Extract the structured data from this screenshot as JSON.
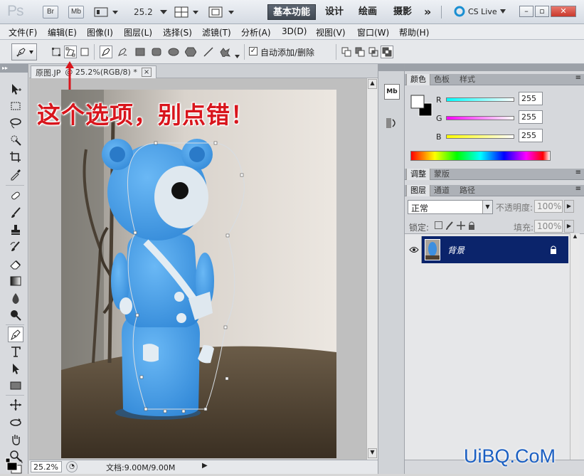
{
  "app": {
    "logo": "Ps"
  },
  "titlebar": {
    "zoom": "25.2",
    "workspaces": [
      "基本功能",
      "设计",
      "绘画",
      "摄影"
    ],
    "more": "»",
    "cslive": "CS Live",
    "br": "Br",
    "mb": "Mb"
  },
  "menu": [
    "文件(F)",
    "编辑(E)",
    "图像(I)",
    "图层(L)",
    "选择(S)",
    "滤镜(T)",
    "分析(A)",
    "3D(D)",
    "视图(V)",
    "窗口(W)",
    "帮助(H)"
  ],
  "options": {
    "auto_add_delete": "自动添加/删除",
    "auto_checked": true
  },
  "document": {
    "tab": "原图.JP",
    "tab_suffix": "@ 25.2%(RGB/8) *",
    "close": "×"
  },
  "annotation": {
    "text": "这个选项，别点错！"
  },
  "status": {
    "zoom": "25.2%",
    "doc": "文档:9.00M/9.00M"
  },
  "color_panel": {
    "tabs": [
      "颜色",
      "色板",
      "样式"
    ],
    "channels": [
      {
        "label": "R",
        "value": "255",
        "color": "#00e6e6"
      },
      {
        "label": "G",
        "value": "255",
        "color": "#e000e0"
      },
      {
        "label": "B",
        "value": "255",
        "color": "#e6e600"
      }
    ]
  },
  "adjust_panel": {
    "tabs": [
      "调整",
      "蒙版"
    ]
  },
  "layers_panel": {
    "tabs": [
      "图层",
      "通道",
      "路径"
    ],
    "blend_mode": "正常",
    "opacity_label": "不透明度:",
    "opacity": "100%",
    "lock_label": "锁定:",
    "fill_label": "填充:",
    "fill": "100%",
    "layer_name": "背景",
    "selected_color": "#0b246b"
  },
  "watermark": "UiBQ.CoM"
}
